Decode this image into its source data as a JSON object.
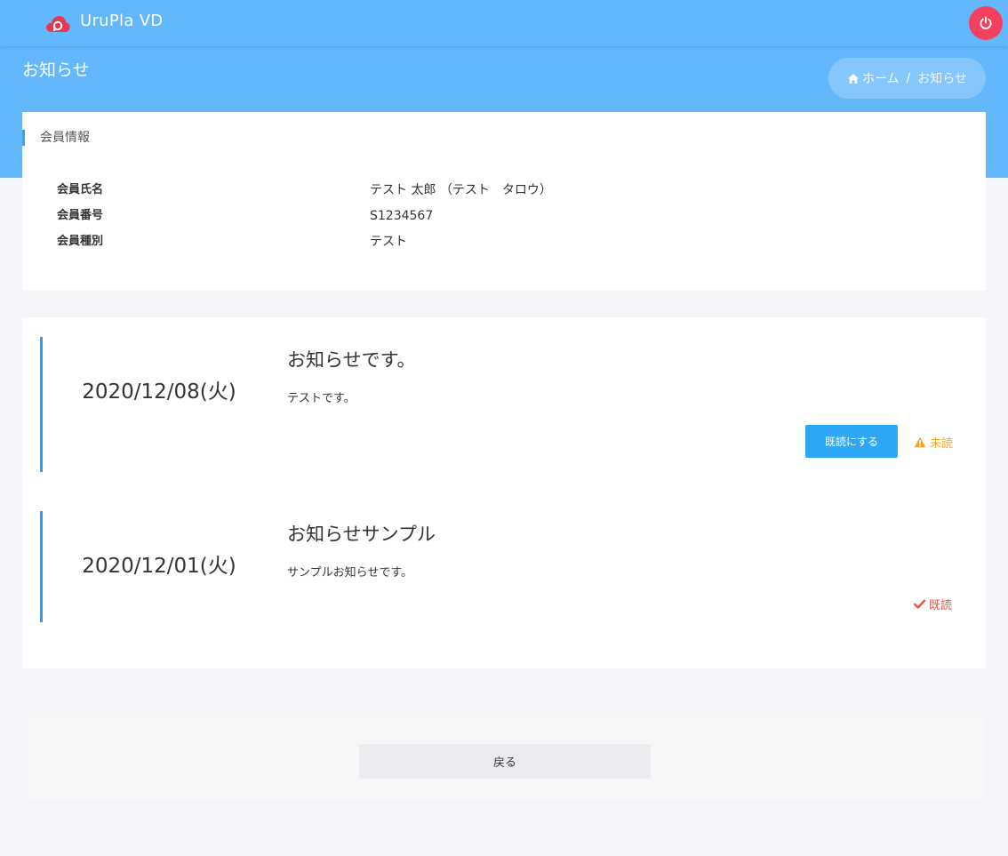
{
  "header": {
    "brand": "UruPla VD",
    "logo_icon": "cloud-logo-icon",
    "power_icon": "power-icon",
    "power_color": "#f2405e",
    "bg_color": "#63b7fd"
  },
  "page": {
    "title": "お知らせ"
  },
  "breadcrumb": {
    "home_label": "ホーム",
    "separator": "/",
    "current": "お知らせ"
  },
  "member_card": {
    "title": "会員情報",
    "rows": [
      {
        "label": "会員氏名",
        "value": "テスト 太郎 （テスト　タロウ）"
      },
      {
        "label": "会員番号",
        "value": "S1234567"
      },
      {
        "label": "会員種別",
        "value": "テスト"
      }
    ]
  },
  "news": [
    {
      "date": "2020/12/08(火)",
      "title": "お知らせです。",
      "body": "テストです。",
      "button_label": "既読にする",
      "status": "未読",
      "status_icon": "warning-icon"
    },
    {
      "date": "2020/12/01(火)",
      "title": "お知らせサンプル",
      "body": "サンプルお知らせです。",
      "status": "既読",
      "status_icon": "check-icon"
    }
  ],
  "footer": {
    "back_label": "戻る"
  }
}
